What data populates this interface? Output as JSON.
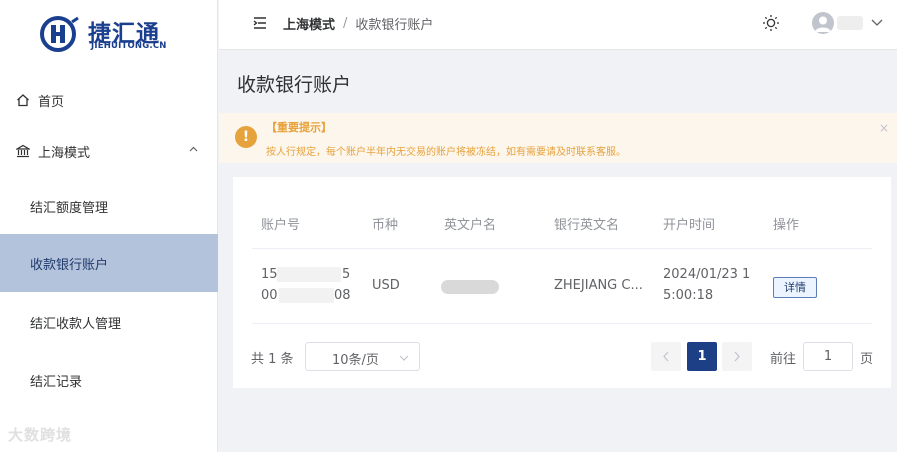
{
  "logo": {
    "main": "捷汇通",
    "sub": "JIEHUITONG.CN"
  },
  "sidebar": {
    "items": [
      {
        "label": "首页"
      },
      {
        "label": "上海模式"
      },
      {
        "label": "结汇额度管理"
      },
      {
        "label": "收款银行账户"
      },
      {
        "label": "结汇收款人管理"
      },
      {
        "label": "结汇记录"
      }
    ]
  },
  "watermark": "大数跨境",
  "header": {
    "breadcrumb": [
      "上海模式",
      "/",
      "收款银行账户"
    ]
  },
  "page": {
    "title": "收款银行账户"
  },
  "alert": {
    "icon": "!",
    "title": "【重要提示】",
    "text": "按人行规定，每个账户半年内无交易的账户将被冻结，如有需要请及时联系客服。",
    "close": "×"
  },
  "table": {
    "headers": [
      "账户号",
      "币种",
      "英文户名",
      "银行英文名",
      "开户时间",
      "操作"
    ],
    "row": {
      "account_line1_start": "15",
      "account_line1_end": "5",
      "account_line2_start": "00",
      "account_line2_end": "08",
      "currency": "USD",
      "bank_name": "ZHEJIANG C...",
      "open_time_line1": "2024/01/23 1",
      "open_time_line2": "5:00:18",
      "action": "详情"
    }
  },
  "pagination": {
    "total": "共 1 条",
    "page_size": "10条/页",
    "current_page": "1",
    "goto_label": "前往",
    "goto_value": "1",
    "goto_unit": "页"
  },
  "colors": {
    "primary": "#1c3f86",
    "active_bg": "#b4c3dc",
    "warning": "#e6a23c",
    "warning_bg": "#fdf6ec"
  }
}
